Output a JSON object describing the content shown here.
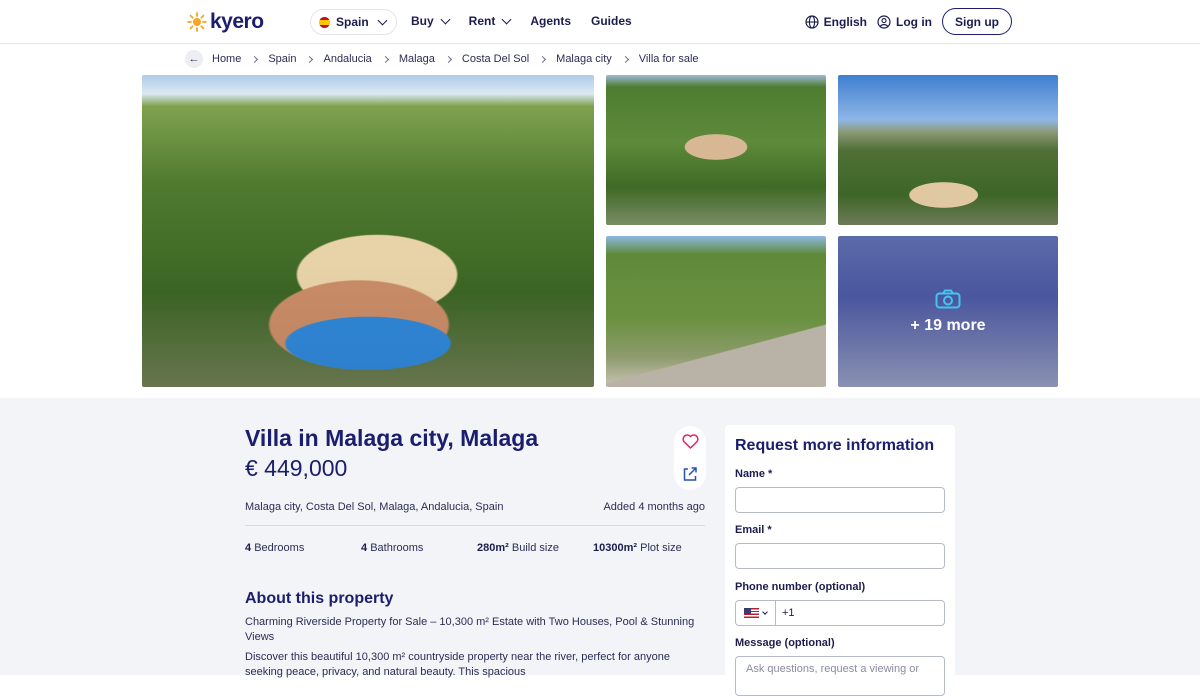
{
  "header": {
    "logo_text": "kyero",
    "country": "Spain",
    "nav": [
      "Buy",
      "Rent",
      "Agents",
      "Guides"
    ],
    "language": "English",
    "login": "Log in",
    "signup": "Sign up"
  },
  "breadcrumb": [
    "Home",
    "Spain",
    "Andalucia",
    "Malaga",
    "Costa Del Sol",
    "Malaga city",
    "Villa for sale"
  ],
  "gallery": {
    "more_label": "+ 19 more"
  },
  "listing": {
    "title": "Villa in Malaga city, Malaga",
    "price": "€ 449,000",
    "location": "Malaga city, Costa Del Sol, Malaga, Andalucia, Spain",
    "added": "Added 4 months ago",
    "facts": [
      {
        "value": "4",
        "label": "Bedrooms"
      },
      {
        "value": "4",
        "label": "Bathrooms"
      },
      {
        "value": "280m²",
        "label": "Build size"
      },
      {
        "value": "10300m²",
        "label": "Plot size"
      }
    ],
    "about_heading": "About this property",
    "about_p1": "Charming Riverside Property for Sale – 10,300 m² Estate with Two Houses, Pool & Stunning Views",
    "about_p2": "Discover this beautiful 10,300 m² countryside property near the river, perfect for anyone seeking peace, privacy, and natural beauty. This spacious"
  },
  "form": {
    "heading": "Request more information",
    "name_label": "Name *",
    "email_label": "Email *",
    "phone_label": "Phone number (optional)",
    "phone_code": "+1",
    "message_label": "Message (optional)",
    "message_placeholder": "Ask questions, request a viewing or"
  },
  "colors": {
    "brand": "#1b1d6e",
    "accent": "#f5a623",
    "background": "#f2f4f7"
  }
}
